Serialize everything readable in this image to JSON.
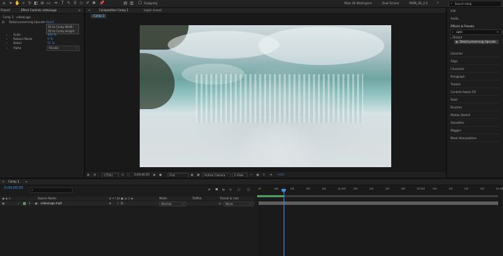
{
  "app": {
    "toolbar": {
      "snapping_label": "Snapping",
      "workspaces": [
        "Main AE Workspace",
        "Dual Screen",
        "MAIN_AE_2.0"
      ],
      "search_help_placeholder": "Search Help"
    },
    "left_panel": {
      "tabs": [
        "Project",
        "Effect Controls videoLogo"
      ],
      "layer_header": "Comp 1 · videoLogo",
      "effect": {
        "name": "Detail-preserving Upscale",
        "reset_label": "Reset"
      },
      "dropdown_options": [
        "Fit to Comp Width",
        "Fit to Comp Height"
      ],
      "params": [
        {
          "label": "Scale",
          "value": "100 %"
        },
        {
          "label": "Reduce Noise",
          "value": "0 %"
        },
        {
          "label": "Detail",
          "value": "51 %"
        },
        {
          "label": "Alpha",
          "value": "Bicubic"
        }
      ]
    },
    "comp_panel": {
      "tab_label": "Composition Comp 1",
      "layer_tab_label": "Layer (none)",
      "comp_name_tab": "Comp 1",
      "footer": {
        "zoom": "(75%)",
        "timecode": "0;00;00;00",
        "resolution": "Full",
        "camera": "Active Camera",
        "views": "1 View",
        "exposure": "+0.0"
      }
    },
    "right_panel": {
      "items_top": [
        "Info",
        "Audio"
      ],
      "effects_header": "Effects & Presets",
      "search_value": "upsc",
      "category": "Distort",
      "result": "Detail-preserving Upscale",
      "panels": [
        "Libraries",
        "Align",
        "Character",
        "Paragraph",
        "Tracker",
        "Content-Aware Fill",
        "Paint",
        "Brushes",
        "Motion Sketch",
        "Smoother",
        "Wiggler",
        "Mask Interpolation"
      ]
    },
    "timeline": {
      "tab_label": "Comp 1",
      "timecode": "0;00;00;00",
      "search_placeholder": "",
      "columns": [
        "Source Name",
        "Mode",
        "TrkMat",
        "Parent & Link"
      ],
      "layer": {
        "index": "1",
        "name": "videoLogo.mp4",
        "mode": "Normal",
        "trkmat": "",
        "parent": "None"
      },
      "ruler_labels": [
        "0f",
        "05f",
        "10f",
        "15f",
        "20f",
        "01:00f",
        "05f",
        "10f",
        "15f",
        "20f",
        "02:00f",
        "05f",
        "10f",
        "15f",
        "20f",
        "03:00f"
      ]
    }
  }
}
